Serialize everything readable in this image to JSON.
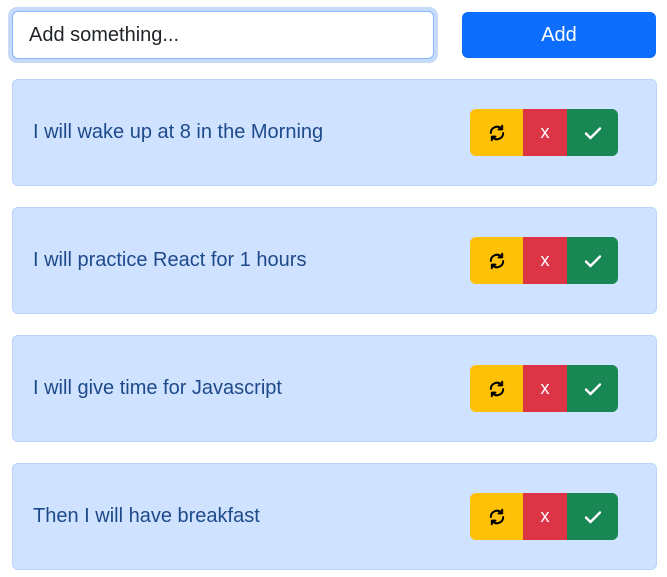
{
  "input": {
    "value": "Add something..."
  },
  "add_button": {
    "label": "Add"
  },
  "todos": [
    {
      "text": "I will wake up at 8 in the Morning",
      "delete_label": "x"
    },
    {
      "text": "I will practice React for 1 hours",
      "delete_label": "x"
    },
    {
      "text": "I will give time for Javascript",
      "delete_label": "x"
    },
    {
      "text": "Then I will have breakfast",
      "delete_label": "x"
    }
  ],
  "icons": {
    "refresh": "refresh-icon",
    "delete": "x",
    "done": "check-icon"
  },
  "colors": {
    "primary": "#0d6efd",
    "item_bg": "#cfe2ff",
    "warning": "#ffc107",
    "danger": "#dc3545",
    "success": "#198754"
  }
}
